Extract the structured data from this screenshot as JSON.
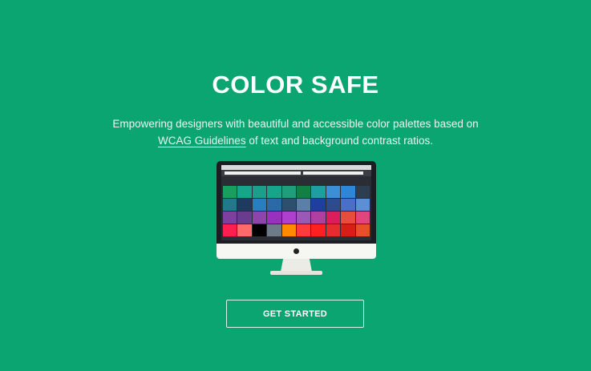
{
  "hero": {
    "title": "COLOR SAFE",
    "tagline_line1": "Empowering designers with beautiful and accessible color palettes based on",
    "tagline_link": "WCAG Guidelines",
    "tagline_line2_rest": " of text and background contrast ratios."
  },
  "cta": {
    "label": "GET STARTED"
  },
  "colors": {
    "background": "#0aa571",
    "text": "#ffffff"
  },
  "monitor_illustration": {
    "swatches": [
      "#16a05e",
      "#17a589",
      "#1aa08a",
      "#16a58a",
      "#1d9f7b",
      "#118045",
      "#1c9fa0",
      "#3a8fd6",
      "#2e86d8",
      "#2c3e50",
      "#1f7a8c",
      "#1f3a5f",
      "#277fbf",
      "#2a6aa8",
      "#2f4f6f",
      "#5a7fa8",
      "#1e3fa0",
      "#2d4c8f",
      "#4a6fc8",
      "#5c8fd6",
      "#7d3fa0",
      "#6a3c8e",
      "#8e44ad",
      "#9b30c0",
      "#b03fd0",
      "#9b59b6",
      "#b040a0",
      "#d91e5b",
      "#e74c3c",
      "#e0457b",
      "#ff1f4f",
      "#ff6b6b",
      "#000000",
      "#6c7a89",
      "#ff8c00",
      "#ff3b3b",
      "#ff2020",
      "#e52d2d",
      "#d91e18",
      "#e8502a"
    ]
  }
}
